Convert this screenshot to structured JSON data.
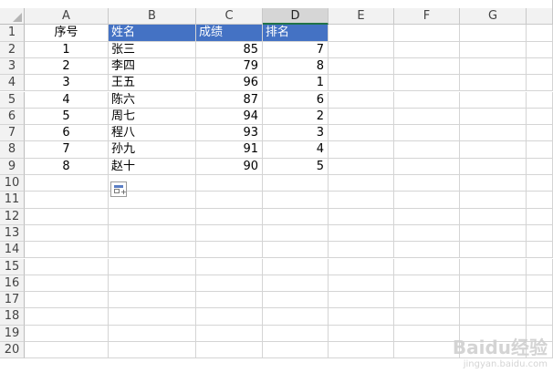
{
  "columns": [
    "A",
    "B",
    "C",
    "D",
    "E",
    "F",
    "G"
  ],
  "row_numbers": [
    "1",
    "2",
    "3",
    "4",
    "5",
    "6",
    "7",
    "8",
    "9",
    "10",
    "11",
    "12",
    "13",
    "14",
    "15",
    "16",
    "17",
    "18",
    "19",
    "20"
  ],
  "headers": {
    "a": "序号",
    "b": "姓名",
    "c": "成绩",
    "d": "排名"
  },
  "rows": [
    {
      "a": "1",
      "b": "张三",
      "c": "85",
      "d": "7"
    },
    {
      "a": "2",
      "b": "李四",
      "c": "79",
      "d": "8"
    },
    {
      "a": "3",
      "b": "王五",
      "c": "96",
      "d": "1"
    },
    {
      "a": "4",
      "b": "陈六",
      "c": "87",
      "d": "6"
    },
    {
      "a": "5",
      "b": "周七",
      "c": "94",
      "d": "2"
    },
    {
      "a": "6",
      "b": "程八",
      "c": "93",
      "d": "3"
    },
    {
      "a": "7",
      "b": "孙九",
      "c": "91",
      "d": "4"
    },
    {
      "a": "8",
      "b": "赵十",
      "c": "90",
      "d": "5"
    }
  ],
  "selected_column": "D",
  "colors": {
    "header_fill": "#4472c4",
    "header_text": "#ffffff",
    "selected_col_header": "#d6d6d6",
    "grid": "#d4d4d4"
  },
  "icons": {
    "quick_analysis": "quick-analysis-icon"
  },
  "watermark": {
    "brand": "Baidu经验",
    "sub": "jingyan.baidu.com"
  }
}
